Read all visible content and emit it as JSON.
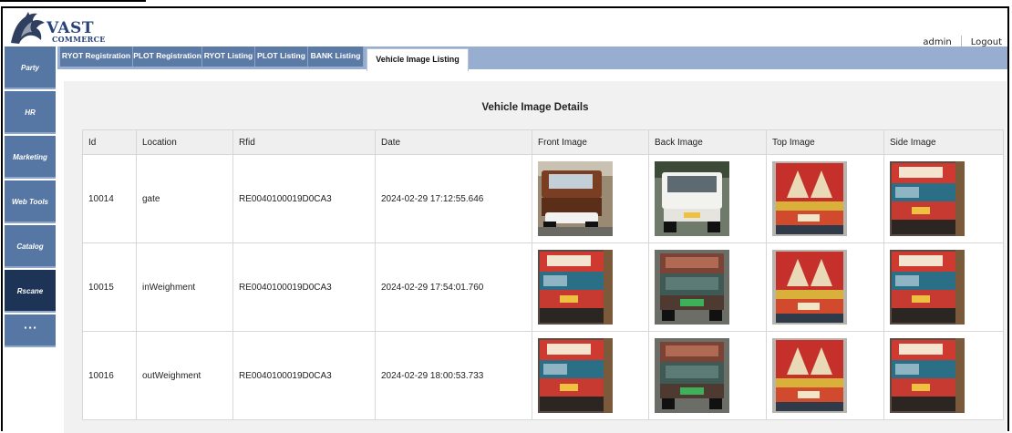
{
  "app": {
    "logo": {
      "line1": "VAST",
      "line2": "COMMERCE"
    },
    "user": "admin",
    "logout_label": "Logout"
  },
  "tabs": [
    {
      "label": "RYOT Registration",
      "active": false
    },
    {
      "label": "PLOT Registration",
      "active": false
    },
    {
      "label": "RYOT Listing",
      "active": false
    },
    {
      "label": "PLOT Listing",
      "active": false
    },
    {
      "label": "BANK Listing",
      "active": false
    },
    {
      "label": "Vehicle Image Listing",
      "active": true
    }
  ],
  "sidebar": {
    "items": [
      {
        "label": "Party"
      },
      {
        "label": "HR"
      },
      {
        "label": "Marketing"
      },
      {
        "label": "Web Tools"
      },
      {
        "label": "Catalog"
      },
      {
        "label": "Rscane"
      },
      {
        "label": "▪ ▪ ▪"
      }
    ]
  },
  "main": {
    "title": "Vehicle Image Details",
    "columns": [
      "Id",
      "Location",
      "Rfid",
      "Date",
      "Front Image",
      "Back Image",
      "Top Image",
      "Side Image"
    ],
    "rows": [
      {
        "id": "10014",
        "location": "gate",
        "rfid": "RE0040100019D0CA3",
        "date": "2024-02-29 17:12:55.646",
        "images": [
          "truck-front-tata-photo",
          "truck-back-white-photo",
          "truck-top-red-panel-photo",
          "truck-side-ndmc-photo"
        ]
      },
      {
        "id": "10015",
        "location": "inWeighment",
        "rfid": "RE0040100019D0CA3",
        "date": "2024-02-29 17:54:01.760",
        "images": [
          "truck-side-ndmc-photo",
          "truck-back-green-photo",
          "truck-top-red-panel-photo",
          "truck-side-ndmc-photo"
        ]
      },
      {
        "id": "10016",
        "location": "outWeighment",
        "rfid": "RE0040100019D0CA3",
        "date": "2024-02-29 18:00:53.733",
        "images": [
          "truck-side-ndmc-photo",
          "truck-back-green-photo",
          "truck-top-red-panel-photo",
          "truck-side-ndmc-photo"
        ]
      }
    ]
  },
  "colors": {
    "sidebar": "#5677a3",
    "sidebar_active": "#1d3457",
    "tab_bg": "#5b7aa6",
    "tabbar": "#98aed0",
    "content_bg": "#f1f1f1"
  }
}
